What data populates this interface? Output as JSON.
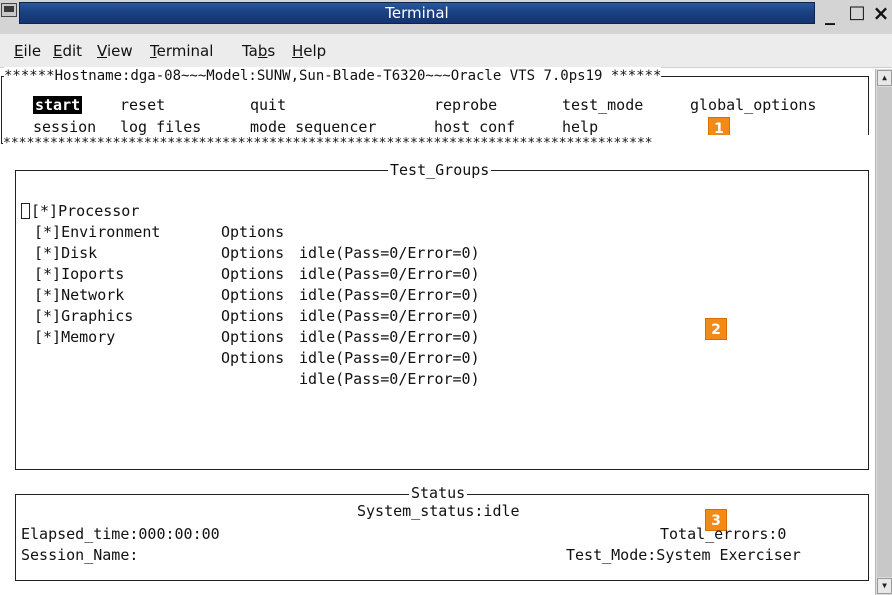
{
  "window": {
    "title": "Terminal",
    "min_label": "_",
    "max_label": "□",
    "close_label": "×"
  },
  "menu": [
    {
      "key": "E",
      "rest": "ile",
      "full": "File"
    },
    {
      "key": "E",
      "rest": "dit",
      "full": "Edit"
    },
    {
      "key": "V",
      "rest": "iew",
      "full": "View"
    },
    {
      "key": "T",
      "rest": "erminal",
      "full": "Terminal"
    },
    {
      "key": "b",
      "pre": "Ta",
      "rest": "s",
      "full": "Tabs"
    },
    {
      "key": "H",
      "rest": "elp",
      "full": "Help"
    }
  ],
  "header": {
    "banner": "******Hostname:dga-08~~~Model:SUNW,Sun-Blade-T6320~~~Oracle VTS 7.0ps19 ******",
    "bottom_rule": "***********************************************************************************",
    "menu_row1": [
      "start",
      "reset",
      "quit",
      "reprobe",
      "test_mode",
      "global_options"
    ],
    "menu_row2": [
      "session",
      "log_files",
      "mode_sequencer",
      "host_conf",
      "help"
    ],
    "selected": "start",
    "badge": "1"
  },
  "test_groups": {
    "title": "Test_Groups",
    "badge": "2",
    "rows": [
      {
        "check": "[*]",
        "name": "Processor",
        "options": "Options",
        "status": "idle(Pass=0/Error=0)"
      },
      {
        "check": "[*]",
        "name": "Environment",
        "options": "Options",
        "status": "idle(Pass=0/Error=0)"
      },
      {
        "check": "[*]",
        "name": "Disk",
        "options": "Options",
        "status": "idle(Pass=0/Error=0)"
      },
      {
        "check": "[*]",
        "name": "Ioports",
        "options": "Options",
        "status": "idle(Pass=0/Error=0)"
      },
      {
        "check": "[*]",
        "name": "Network",
        "options": "Options",
        "status": "idle(Pass=0/Error=0)"
      },
      {
        "check": "[*]",
        "name": "Graphics",
        "options": "Options",
        "status": "idle(Pass=0/Error=0)"
      },
      {
        "check": "[*]",
        "name": "Memory",
        "options": "Options",
        "status": "idle(Pass=0/Error=0)"
      }
    ]
  },
  "status": {
    "title": "Status",
    "badge": "3",
    "system_status": "System_status:idle",
    "elapsed": "Elapsed_time:000:00:00",
    "total_errors": "Total_errors:0",
    "session_name": "Session_Name:",
    "test_mode": "Test_Mode:System Exerciser"
  },
  "colors": {
    "titlebar": "#1a4080",
    "badge": "#f28a18",
    "selected_bg": "#000000"
  },
  "icons": {
    "window": "terminal-icon",
    "scroll_up": "arrow-up-icon",
    "scroll_down": "arrow-down-icon"
  }
}
